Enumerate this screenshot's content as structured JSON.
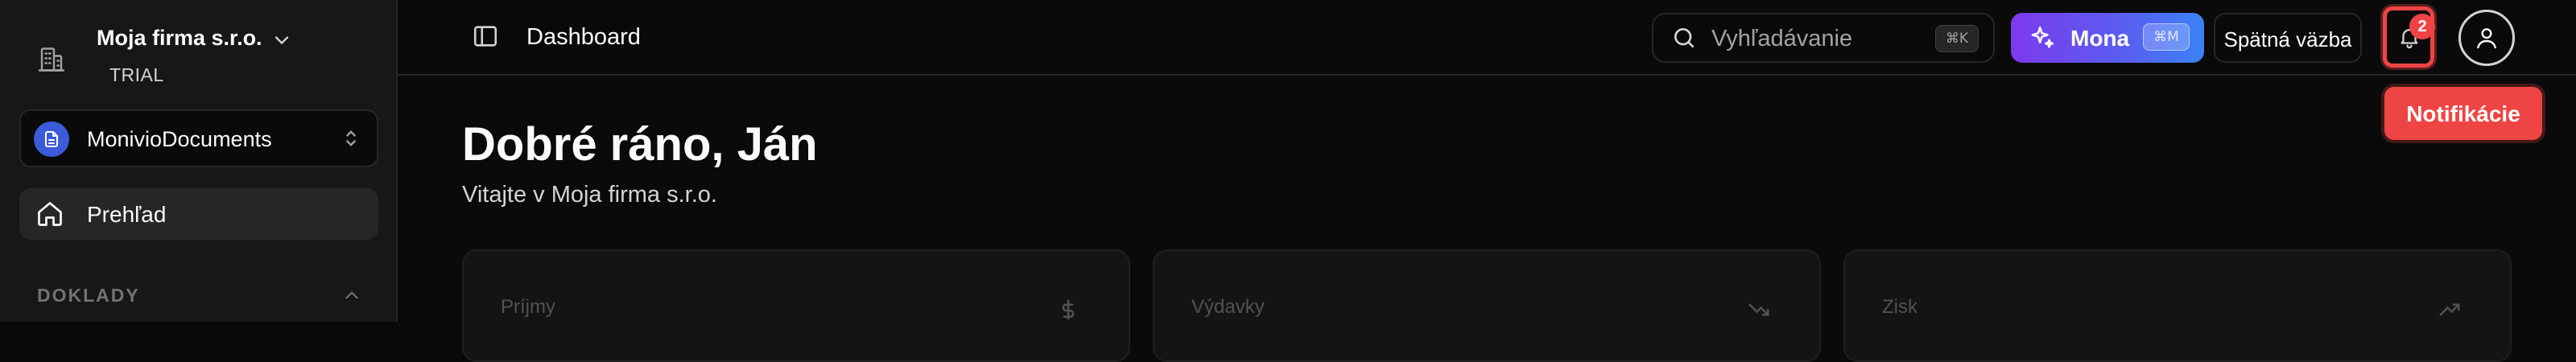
{
  "organization": {
    "name": "Moja firma s.r.o.",
    "plan": "TRIAL"
  },
  "product": {
    "name": "MonivioDocuments"
  },
  "sidebar": {
    "items": [
      {
        "label": "Prehľad"
      }
    ],
    "section": {
      "label": "DOKLADY"
    }
  },
  "header": {
    "title": "Dashboard",
    "search": {
      "placeholder": "Vyhľadávanie",
      "shortcut": "⌘K"
    },
    "mona": {
      "label": "Mona",
      "shortcut": "⌘M"
    },
    "feedback_label": "Spätná väzba",
    "notifications": {
      "count": "2",
      "tooltip": "Notifikácie"
    }
  },
  "main": {
    "greeting": "Dobré ráno, Ján",
    "subtitle": "Vitajte v Moja firma s.r.o.",
    "cards": [
      {
        "label": "Príjmy"
      },
      {
        "label": "Výdavky"
      },
      {
        "label": "Zisk"
      }
    ]
  },
  "colors": {
    "accent": "#5b5cf0",
    "danger": "#ef4444",
    "background": "#0a0a0a"
  }
}
